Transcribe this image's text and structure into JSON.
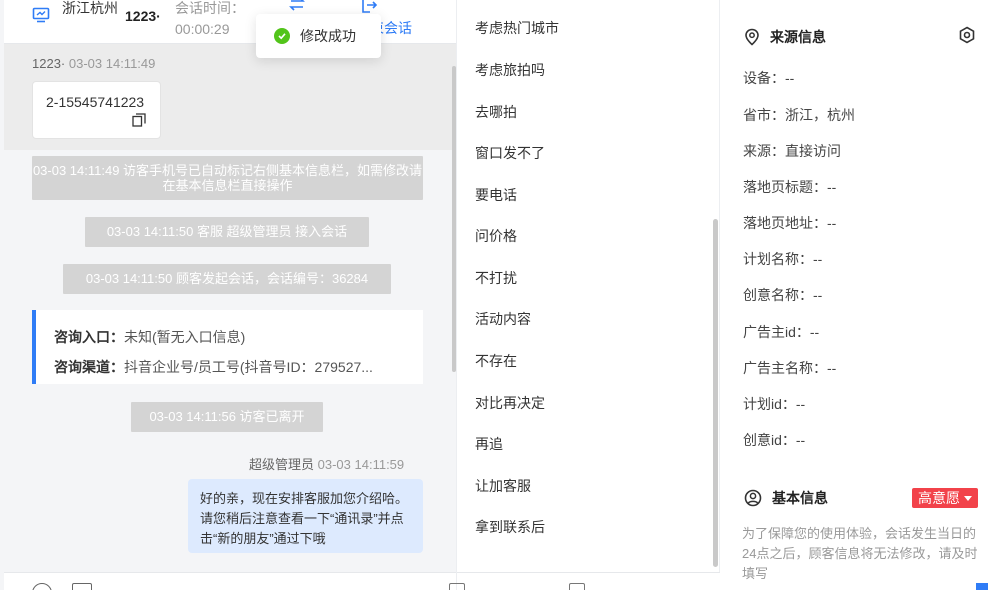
{
  "header": {
    "city": "浙江杭州",
    "visitor_id": "1223·",
    "time_label": "会话时间：",
    "time_value": "00:00:29",
    "end_label": "束会话"
  },
  "toast": {
    "text": "修改成功"
  },
  "messages": {
    "first": {
      "sender": "1223·",
      "time": "03-03 14:11:49",
      "content": "2-15545741223"
    },
    "system": [
      "03-03 14:11:49 访客手机号已自动标记右侧基本信息栏，如需修改请在基本信息栏直接操作",
      "03-03 14:11:50 客服 超级管理员 接入会话",
      "03-03 14:11:50 顾客发起会话，会话编号：36284",
      "03-03 14:11:56 访客已离开"
    ],
    "consult": {
      "entry_key": "咨询入口：",
      "entry_val": "未知(暂无入口信息)",
      "channel_key": "咨询渠道：",
      "channel_val": "抖音企业号/员工号(抖音号ID：279527..."
    },
    "outgoing": {
      "sender": "超级管理员",
      "time": "03-03 14:11:59",
      "content": "好的亲，现在安排客服加您介绍哈。请您稍后注意查看一下“通讯录”并点击“新的朋友”通过下哦"
    }
  },
  "quick_replies": [
    "考虑热门城市",
    "考虑旅拍吗",
    "去哪拍",
    "窗口发不了",
    "要电话",
    "问价格",
    "不打扰",
    "活动内容",
    "不存在",
    "对比再决定",
    "再追",
    "让加客服",
    "拿到联系后"
  ],
  "source_info": {
    "title": "来源信息",
    "items": [
      "设备：--",
      "省市：浙江，杭州",
      "来源：直接访问",
      "落地页标题：--",
      "落地页地址：--",
      "计划名称：--",
      "创意名称：--",
      "广告主id：--",
      "广告主名称：--",
      "计划id：--",
      "创意id：--"
    ]
  },
  "basic_info": {
    "title": "基本信息",
    "intent": "高意愿",
    "notice": "为了保障您的使用体验，会话发生当日的24点之后，顾客信息将无法修改，请及时填写"
  },
  "colors": {
    "accent": "#2f7cf6",
    "success": "#52c41a",
    "badge": "#f2424a"
  }
}
